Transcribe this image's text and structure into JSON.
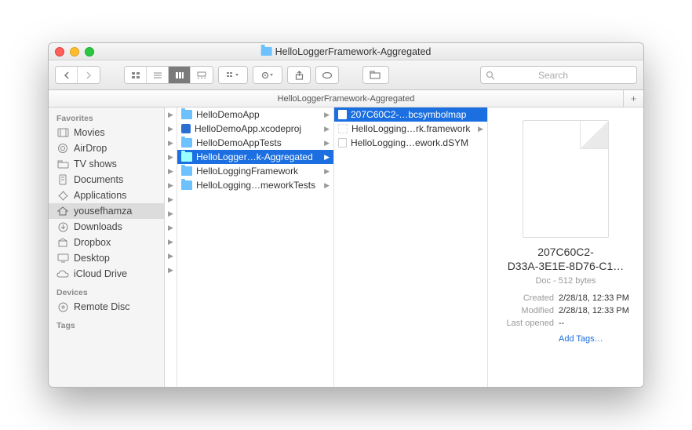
{
  "window": {
    "title": "HelloLoggerFramework-Aggregated"
  },
  "pathbar": {
    "title": "HelloLoggerFramework-Aggregated"
  },
  "search": {
    "placeholder": "Search"
  },
  "sidebar": {
    "sections": [
      {
        "label": "Favorites",
        "items": [
          {
            "label": "Movies",
            "icon": "film"
          },
          {
            "label": "AirDrop",
            "icon": "airdrop"
          },
          {
            "label": "TV shows",
            "icon": "folder"
          },
          {
            "label": "Documents",
            "icon": "doc"
          },
          {
            "label": "Applications",
            "icon": "apps"
          },
          {
            "label": "yousefhamza",
            "icon": "home",
            "selected": true
          },
          {
            "label": "Downloads",
            "icon": "download"
          },
          {
            "label": "Dropbox",
            "icon": "dropbox"
          },
          {
            "label": "Desktop",
            "icon": "desktop"
          },
          {
            "label": "iCloud Drive",
            "icon": "cloud"
          }
        ]
      },
      {
        "label": "Devices",
        "items": [
          {
            "label": "Remote Disc",
            "icon": "disc"
          }
        ]
      },
      {
        "label": "Tags",
        "items": []
      }
    ]
  },
  "columns": {
    "col1": [
      {
        "label": "HelloDemoApp",
        "icon": "folder",
        "chev": true
      },
      {
        "label": "HelloDemoApp.xcodeproj",
        "icon": "xcode",
        "chev": true
      },
      {
        "label": "HelloDemoAppTests",
        "icon": "folder",
        "chev": true
      },
      {
        "label": "HelloLogger…k-Aggregated",
        "icon": "folder",
        "chev": true,
        "selected": true
      },
      {
        "label": "HelloLoggingFramework",
        "icon": "folder",
        "chev": true
      },
      {
        "label": "HelloLogging…meworkTests",
        "icon": "folder",
        "chev": true
      }
    ],
    "col2": [
      {
        "label": "207C60C2-…bcsymbolmap",
        "icon": "file",
        "selected": true
      },
      {
        "label": "HelloLogging…rk.framework",
        "icon": "blank",
        "chev": true
      },
      {
        "label": "HelloLogging…ework.dSYM",
        "icon": "file"
      }
    ]
  },
  "preview": {
    "name_line1": "207C60C2-",
    "name_line2": "D33A-3E1E-8D76-C1…",
    "sub": "Doc - 512 bytes",
    "created_k": "Created",
    "created_v": "2/28/18, 12:33 PM",
    "modified_k": "Modified",
    "modified_v": "2/28/18, 12:33 PM",
    "lastopened_k": "Last opened",
    "lastopened_v": "--",
    "add_tags": "Add Tags…"
  }
}
